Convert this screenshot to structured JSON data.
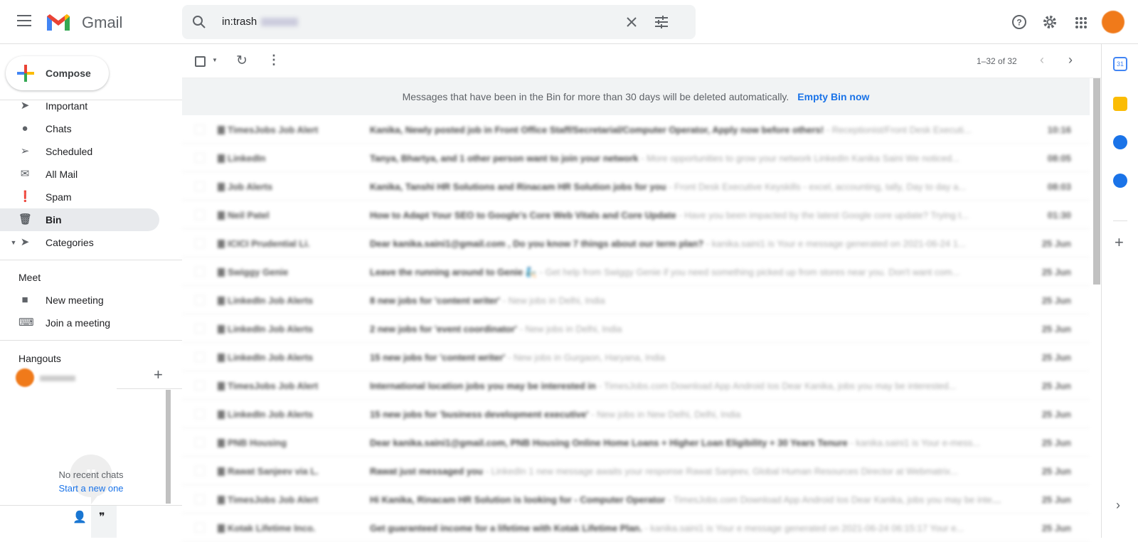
{
  "header": {
    "app_name": "Gmail",
    "search_value": "in:trash",
    "icons": [
      "menu-icon",
      "search-icon",
      "close-icon",
      "tune-icon",
      "help-icon",
      "settings-icon",
      "apps-icon"
    ]
  },
  "sidebar": {
    "compose_label": "Compose",
    "items": [
      {
        "label": "Important",
        "icon": "important-icon"
      },
      {
        "label": "Chats",
        "icon": "chat-icon"
      },
      {
        "label": "Scheduled",
        "icon": "schedule-icon"
      },
      {
        "label": "All Mail",
        "icon": "mail-icon"
      },
      {
        "label": "Spam",
        "icon": "spam-icon"
      },
      {
        "label": "Bin",
        "icon": "trash-icon",
        "active": true
      },
      {
        "label": "Categories",
        "icon": "label-icon"
      }
    ],
    "meet": {
      "title": "Meet",
      "new_meeting": "New meeting",
      "join": "Join a meeting"
    },
    "hangouts": {
      "title": "Hangouts",
      "empty": "No recent chats",
      "start": "Start a new one"
    }
  },
  "toolbar": {
    "pagination": "1–32 of 32"
  },
  "banner": {
    "text": "Messages that have been in the Bin for more than 30 days will be deleted automatically.",
    "action": "Empty Bin now"
  },
  "emails": [
    {
      "sender": "TimesJobs Job Alert",
      "subject": "Kanika, Newly posted job in Front Office Staff/Secretarial/Computer Operator, Apply now before others!",
      "snippet": " - Receptionist/Front Desk Executi...",
      "date": "10:16"
    },
    {
      "sender": "LinkedIn",
      "subject": "Tanya, Bhartya, and 1 other person want to join your network",
      "snippet": " - More opportunities to grow your network LinkedIn Kanika Saini We noticed...",
      "date": "08:05"
    },
    {
      "sender": "Job Alerts",
      "subject": "Kanika, Tanshi HR Solutions and Rinacam HR Solution jobs for you",
      "snippet": " - Front Desk Executive Keyskills - excel, accounting, tally, Day to day a...",
      "date": "08:03"
    },
    {
      "sender": "Neil Patel",
      "subject": "How to Adapt Your SEO to Google's Core Web Vitals and Core Update",
      "snippet": " - Have you been impacted by the latest Google core update? Trying t...",
      "date": "01:30"
    },
    {
      "sender": "ICICI Prudential Li.",
      "subject": "Dear kanika.saini1@gmail.com , Do you know 7 things about our term plan?",
      "snippet": " - kanika.saini1 is Your e message generated on 2021-06-24 1...",
      "date": "25 Jun"
    },
    {
      "sender": "Swiggy Genie",
      "subject": "Leave the running around to Genie 🧞",
      "snippet": " - Get help from Swiggy Genie if you need something picked up from stores near you. Don't want com...",
      "date": "25 Jun"
    },
    {
      "sender": "LinkedIn Job Alerts",
      "subject": "8 new jobs for 'content writer'",
      "snippet": " - New jobs in Delhi, India",
      "date": "25 Jun"
    },
    {
      "sender": "LinkedIn Job Alerts",
      "subject": "2 new jobs for 'event coordinator'",
      "snippet": " - New jobs in Delhi, India",
      "date": "25 Jun"
    },
    {
      "sender": "LinkedIn Job Alerts",
      "subject": "15 new jobs for 'content writer'",
      "snippet": " - New jobs in Gurgaon, Haryana, India",
      "date": "25 Jun"
    },
    {
      "sender": "TimesJobs Job Alert",
      "subject": "International location jobs you may be interested in",
      "snippet": " - TimesJobs.com Download App Android Ios Dear Kanika, jobs you may be interested...",
      "date": "25 Jun"
    },
    {
      "sender": "LinkedIn Job Alerts",
      "subject": "15 new jobs for 'business development executive'",
      "snippet": " - New jobs in New Delhi, Delhi, India",
      "date": "25 Jun"
    },
    {
      "sender": "PNB Housing",
      "subject": "Dear kanika.saini1@gmail.com, PNB Housing Online Home Loans + Higher Loan Eligibility + 30 Years Tenure",
      "snippet": " - kanika.saini1 is Your e-mess...",
      "date": "25 Jun"
    },
    {
      "sender": "Rawat Sanjeev via L.",
      "subject": "Rawat just messaged you",
      "snippet": " - LinkedIn 1 new message awaits your response Rawat Sanjeev, Global Human Resources Director at Webmatrix...",
      "date": "25 Jun"
    },
    {
      "sender": "TimesJobs Job Alert",
      "subject": "Hi Kanika, Rinacam HR Solution is looking for - Computer Operator",
      "snippet": " - TimesJobs.com Download App Android Ios Dear Kanika, jobs you may be interested...",
      "date": "25 Jun"
    },
    {
      "sender": "Kotak Lifetime Inco.",
      "subject": "Get guaranteed income for a lifetime with Kotak Lifetime Plan.",
      "snippet": " - kanika.saini1 is Your e message generated on 2021-06-24 06:15:17 Your e...",
      "date": "25 Jun"
    }
  ],
  "colors": {
    "accent": "#1a73e8",
    "active_nav": "#e8eaed",
    "avatar": "#f07a1a"
  }
}
